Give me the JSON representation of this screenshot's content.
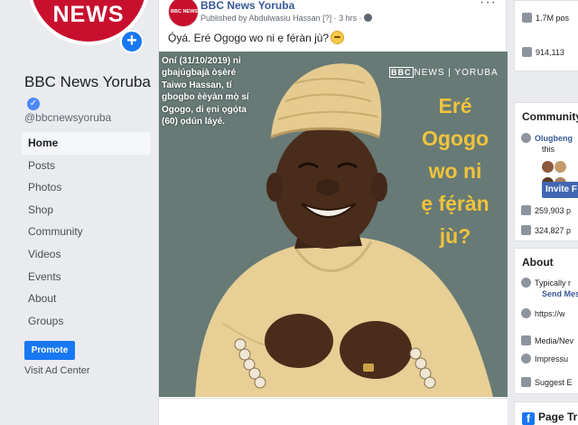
{
  "colors": {
    "brand_red": "#c8102e",
    "fb_blue": "#1877f2",
    "link": "#385898",
    "gold": "#f0c33c"
  },
  "profile": {
    "logo_text": "NEWS",
    "plus": "+",
    "name": "BBC News Yoruba",
    "handle": "@bbcnewsyoruba",
    "verified_mark": "✓"
  },
  "nav": {
    "items": [
      {
        "label": "Home",
        "active": true
      },
      {
        "label": "Posts"
      },
      {
        "label": "Photos"
      },
      {
        "label": "Shop"
      },
      {
        "label": "Community"
      },
      {
        "label": "Videos"
      },
      {
        "label": "Events"
      },
      {
        "label": "About"
      },
      {
        "label": "Groups"
      }
    ],
    "promote_label": "Promote",
    "ad_center_label": "Visit Ad Center"
  },
  "post": {
    "avatar_text": "BBC NEWS",
    "author": "BBC News Yoruba",
    "meta": "Published by Abdulwasiu Hassan [?] · 3 hrs ·",
    "more": "···",
    "text": "Ọ́yá. Eré Ogogo wo ni ẹ fẹ́ràn jù?",
    "image": {
      "caption": "Oní (31/10/2019) ni gbajúgbajà òṣèré Taiwo Hassan, tí gbogbo èèyàn mọ̀ sí Ogogo, di ẹni ọgọ́ta (60) ọdún láyé.",
      "brand_bbc": "BBC",
      "brand_text": "NEWS | YORUBA",
      "question_lines": [
        "Eré",
        "Ogogo",
        "wo ni",
        "ẹ fẹ́ràn",
        "jù?"
      ]
    }
  },
  "right": {
    "stats": [
      {
        "text": "1.7M pos",
        "icon": "like-icon"
      },
      {
        "text": "914,113",
        "icon": "followers-icon"
      }
    ],
    "community": {
      "title": "Community",
      "friend_name": "Olugbeng",
      "friend_suffix": "this",
      "invite_label": "Invite F",
      "likes": "259,903 p",
      "follows": "324,827 p"
    },
    "about": {
      "title": "About",
      "typically": "Typically r",
      "send": "Send Mes",
      "url": "https://w",
      "category": "Media/Nev",
      "impressum": "Impressu",
      "suggest": "Suggest E"
    },
    "page_title": "Page Tr"
  }
}
